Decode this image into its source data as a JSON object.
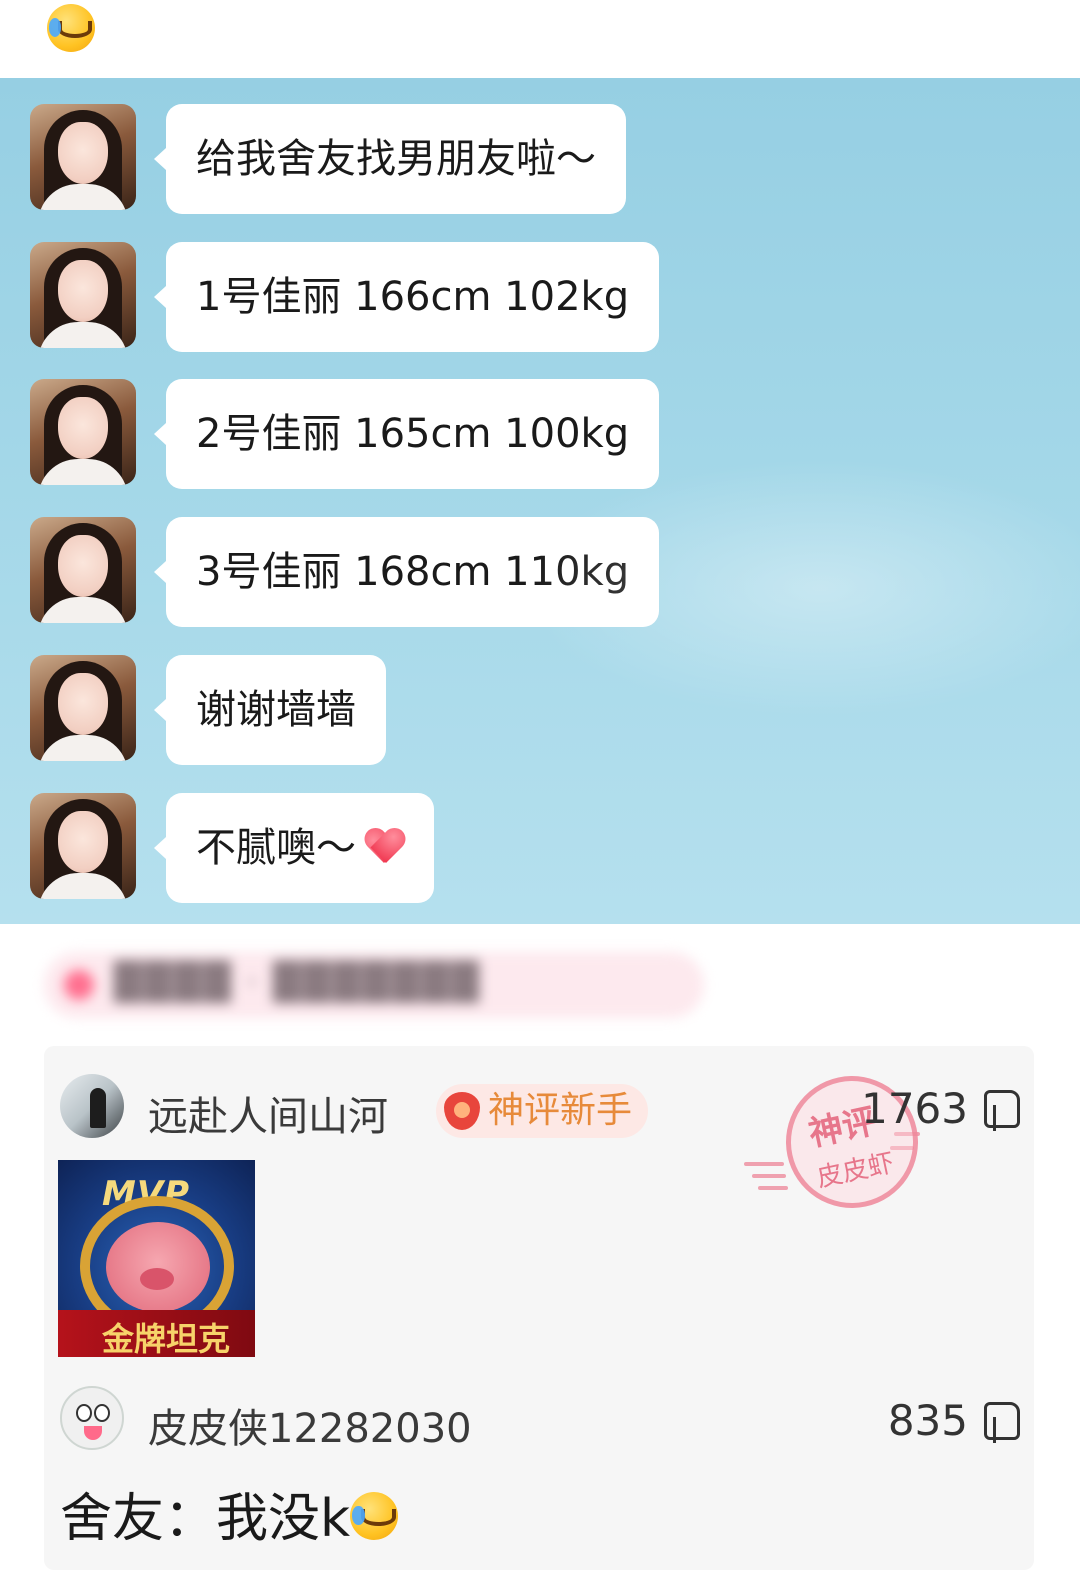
{
  "chat": {
    "messages": [
      {
        "text": "给我舍友找男朋友啦～"
      },
      {
        "text": "1号佳丽 166cm 102kg"
      },
      {
        "text": "2号佳丽 165cm 100kg"
      },
      {
        "text": "3号佳丽 168cm 110kg"
      },
      {
        "text": "谢谢墙墙"
      },
      {
        "text": "不腻噢～"
      }
    ]
  },
  "comments": [
    {
      "username": "远赴人间山河",
      "badge": "神评新手",
      "likes": "1763",
      "stamp_line1": "神评",
      "stamp_line2": "皮皮虾",
      "sticker_title": "MVP",
      "sticker_banner": "金牌坦克"
    },
    {
      "username": "皮皮侠12282030",
      "likes": "835",
      "text": "舍友：我没k"
    }
  ],
  "icons": {
    "top_emoji": "laughing-crying-emoji-icon",
    "heart": "red-heart-icon",
    "like": "thumbs-up-icon"
  },
  "colors": {
    "chat_background": "#a3d7e8",
    "bubble": "#ffffff",
    "badge_text": "#e78a3a",
    "badge_bg": "#fde8e5",
    "stamp": "#e3627a"
  }
}
